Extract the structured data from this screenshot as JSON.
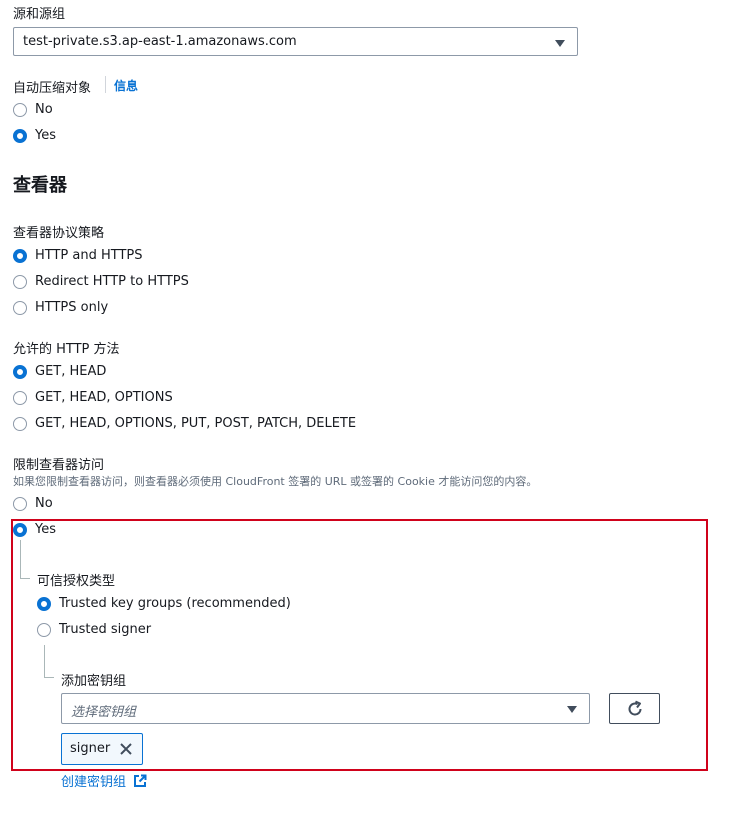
{
  "origin": {
    "label": "源和源组",
    "selected": "test-private.s3.ap-east-1.amazonaws.com"
  },
  "compress": {
    "label": "自动压缩对象",
    "info_link": "信息",
    "options": [
      "No",
      "Yes"
    ],
    "selected": "Yes"
  },
  "viewer": {
    "heading": "查看器",
    "protocol": {
      "label": "查看器协议策略",
      "options": [
        "HTTP and HTTPS",
        "Redirect HTTP to HTTPS",
        "HTTPS only"
      ],
      "selected": "HTTP and HTTPS"
    },
    "methods": {
      "label": "允许的 HTTP 方法",
      "options": [
        "GET, HEAD",
        "GET, HEAD, OPTIONS",
        "GET, HEAD, OPTIONS, PUT, POST, PATCH, DELETE"
      ],
      "selected": "GET, HEAD"
    },
    "restrict": {
      "label": "限制查看器访问",
      "description": "如果您限制查看器访问，则查看器必须使用 CloudFront 签署的 URL 或签署的 Cookie 才能访问您的内容。",
      "options": [
        "No",
        "Yes"
      ],
      "selected": "Yes"
    },
    "trusted_type": {
      "label": "可信授权类型",
      "options": [
        "Trusted key groups (recommended)",
        "Trusted signer"
      ],
      "selected": "Trusted key groups (recommended)"
    },
    "key_groups": {
      "label": "添加密钥组",
      "placeholder": "选择密钥组",
      "tokens": [
        "signer"
      ],
      "create_link": "创建密钥组"
    }
  },
  "colors": {
    "accent": "#0972d3",
    "highlight_border": "#d0021b",
    "text": "#16191f",
    "muted": "#5f6b7a"
  }
}
